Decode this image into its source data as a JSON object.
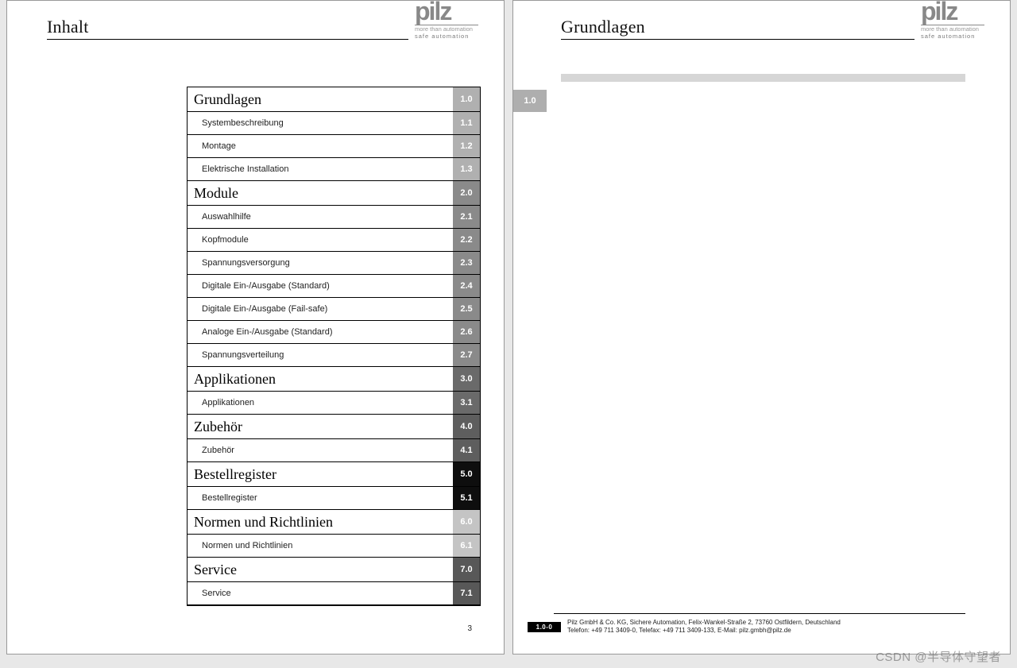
{
  "brand": {
    "logo": "pilz",
    "tag1": "more than automation",
    "tag2": "safe automation"
  },
  "leftPage": {
    "title": "Inhalt",
    "pageNumber": "3",
    "toc": [
      {
        "type": "head",
        "label": "Grundlagen",
        "num": "1.0",
        "color": "c-light"
      },
      {
        "type": "sub",
        "label": "Systembeschreibung",
        "num": "1.1",
        "color": "c-light"
      },
      {
        "type": "sub",
        "label": "Montage",
        "num": "1.2",
        "color": "c-light"
      },
      {
        "type": "sub",
        "label": "Elektrische Installation",
        "num": "1.3",
        "color": "c-light"
      },
      {
        "type": "head",
        "label": "Module",
        "num": "2.0",
        "color": "c-med"
      },
      {
        "type": "sub",
        "label": "Auswahlhilfe",
        "num": "2.1",
        "color": "c-med"
      },
      {
        "type": "sub",
        "label": "Kopfmodule",
        "num": "2.2",
        "color": "c-med"
      },
      {
        "type": "sub",
        "label": "Spannungsversorgung",
        "num": "2.3",
        "color": "c-med"
      },
      {
        "type": "sub",
        "label": "Digitale Ein-/Ausgabe (Standard)",
        "num": "2.4",
        "color": "c-med"
      },
      {
        "type": "sub",
        "label": "Digitale Ein-/Ausgabe (Fail-safe)",
        "num": "2.5",
        "color": "c-med"
      },
      {
        "type": "sub",
        "label": "Analoge Ein-/Ausgabe (Standard)",
        "num": "2.6",
        "color": "c-med"
      },
      {
        "type": "sub",
        "label": "Spannungsverteilung",
        "num": "2.7",
        "color": "c-med"
      },
      {
        "type": "head",
        "label": "Applikationen",
        "num": "3.0",
        "color": "c-gray6"
      },
      {
        "type": "sub",
        "label": "Applikationen",
        "num": "3.1",
        "color": "c-gray6"
      },
      {
        "type": "head",
        "label": "Zubehör",
        "num": "4.0",
        "color": "c-gray5"
      },
      {
        "type": "sub",
        "label": "Zubehör",
        "num": "4.1",
        "color": "c-gray5"
      },
      {
        "type": "head",
        "label": "Bestellregister",
        "num": "5.0",
        "color": "c-black"
      },
      {
        "type": "sub",
        "label": "Bestellregister",
        "num": "5.1",
        "color": "c-black"
      },
      {
        "type": "head",
        "label": "Normen und Richtlinien",
        "num": "6.0",
        "color": "c-faint"
      },
      {
        "type": "sub",
        "label": "Normen und Richtlinien",
        "num": "6.1",
        "color": "c-faint"
      },
      {
        "type": "head",
        "label": "Service",
        "num": "7.0",
        "color": "c-dark"
      },
      {
        "type": "sub",
        "label": "Service",
        "num": "7.1",
        "color": "c-dark"
      }
    ]
  },
  "rightPage": {
    "title": "Grundlagen",
    "sideTab": "1.0",
    "footerBadge": "1.0-0",
    "footerLine1": "Pilz GmbH & Co. KG, Sichere Automation, Felix-Wankel-Straße 2, 73760 Ostfildern, Deutschland",
    "footerLine2": "Telefon: +49 711 3409-0, Telefax: +49 711 3409-133, E-Mail: pilz.gmbh@pilz.de"
  },
  "watermark": "CSDN @半导体守望者"
}
